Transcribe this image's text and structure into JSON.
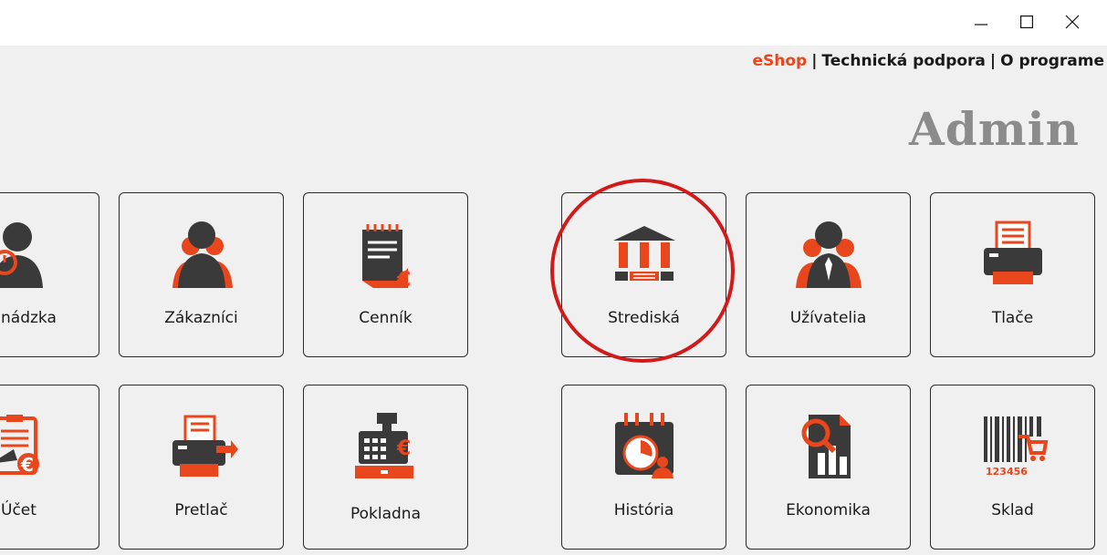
{
  "window": {
    "minimize_icon": "minimize-icon",
    "maximize_icon": "maximize-icon",
    "close_icon": "close-icon"
  },
  "header": {
    "links": [
      {
        "label": "eShop",
        "color": "#e8461c"
      },
      {
        "label": "Technická podpora"
      },
      {
        "label": "O programe"
      }
    ],
    "separator": "|",
    "user": "Admin"
  },
  "tiles_left": [
    {
      "label": "nádzka",
      "icon": "user-icon"
    },
    {
      "label": "Zákazníci",
      "icon": "customers-icon"
    },
    {
      "label": "Cenník",
      "icon": "pricelist-icon"
    },
    {
      "label": "Účet",
      "icon": "invoice-icon"
    },
    {
      "label": "Pretlač",
      "icon": "reprint-icon"
    },
    {
      "label": "Pokladna",
      "icon": "cash-register-icon"
    }
  ],
  "tiles_right": [
    {
      "label": "Strediská",
      "icon": "bank-building-icon",
      "highlighted": true
    },
    {
      "label": "Užívatelia",
      "icon": "users-icon"
    },
    {
      "label": "Tlače",
      "icon": "printer-icon"
    },
    {
      "label": "História",
      "icon": "calendar-history-icon"
    },
    {
      "label": "Ekonomika",
      "icon": "economy-chart-icon"
    },
    {
      "label": "Sklad",
      "icon": "barcode-cart-icon"
    }
  ],
  "colors": {
    "accent": "#e8461c",
    "icon_dark": "#3a3a3a",
    "highlight_circle": "#d11a1a",
    "admin_text": "#8b8b8b"
  }
}
